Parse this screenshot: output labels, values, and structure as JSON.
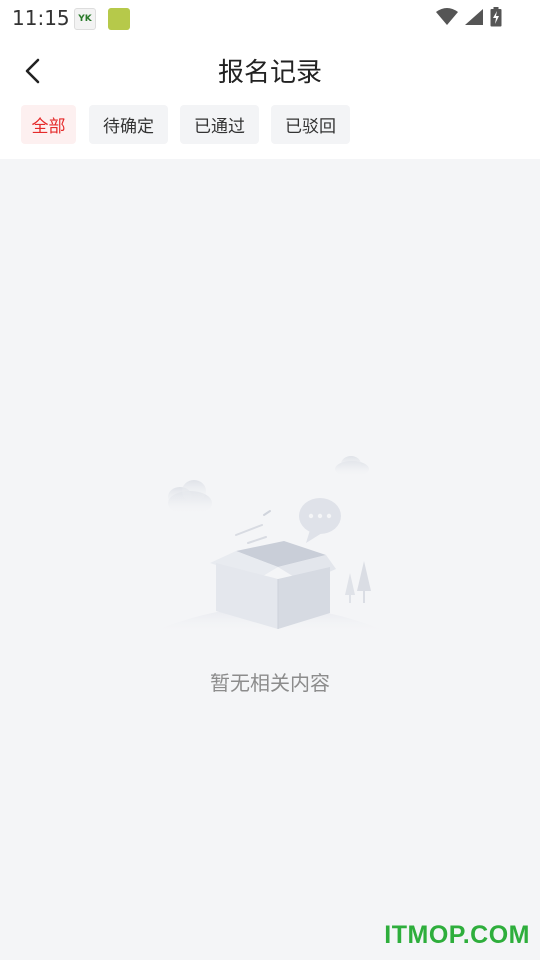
{
  "status_bar": {
    "time": "11:15",
    "app_icons": [
      "yk-app-icon",
      "green-app-icon"
    ],
    "app_icon_1_text": "YK",
    "icons": [
      "wifi-icon",
      "signal-icon",
      "battery-charging-icon"
    ]
  },
  "header": {
    "title": "报名记录",
    "back_icon": "chevron-left-icon"
  },
  "tabs": [
    {
      "label": "全部",
      "active": true
    },
    {
      "label": "待确定",
      "active": false
    },
    {
      "label": "已通过",
      "active": false
    },
    {
      "label": "已驳回",
      "active": false
    }
  ],
  "empty_state": {
    "text": "暂无相关内容",
    "illustration": "empty-box-illustration"
  },
  "watermark": "ITMOP.COM",
  "colors": {
    "accent": "#e52a2a",
    "active_tab_bg": "#fdf0f0",
    "tab_bg": "#f3f4f6",
    "content_bg": "#f4f5f7",
    "watermark": "#2eae3c"
  }
}
